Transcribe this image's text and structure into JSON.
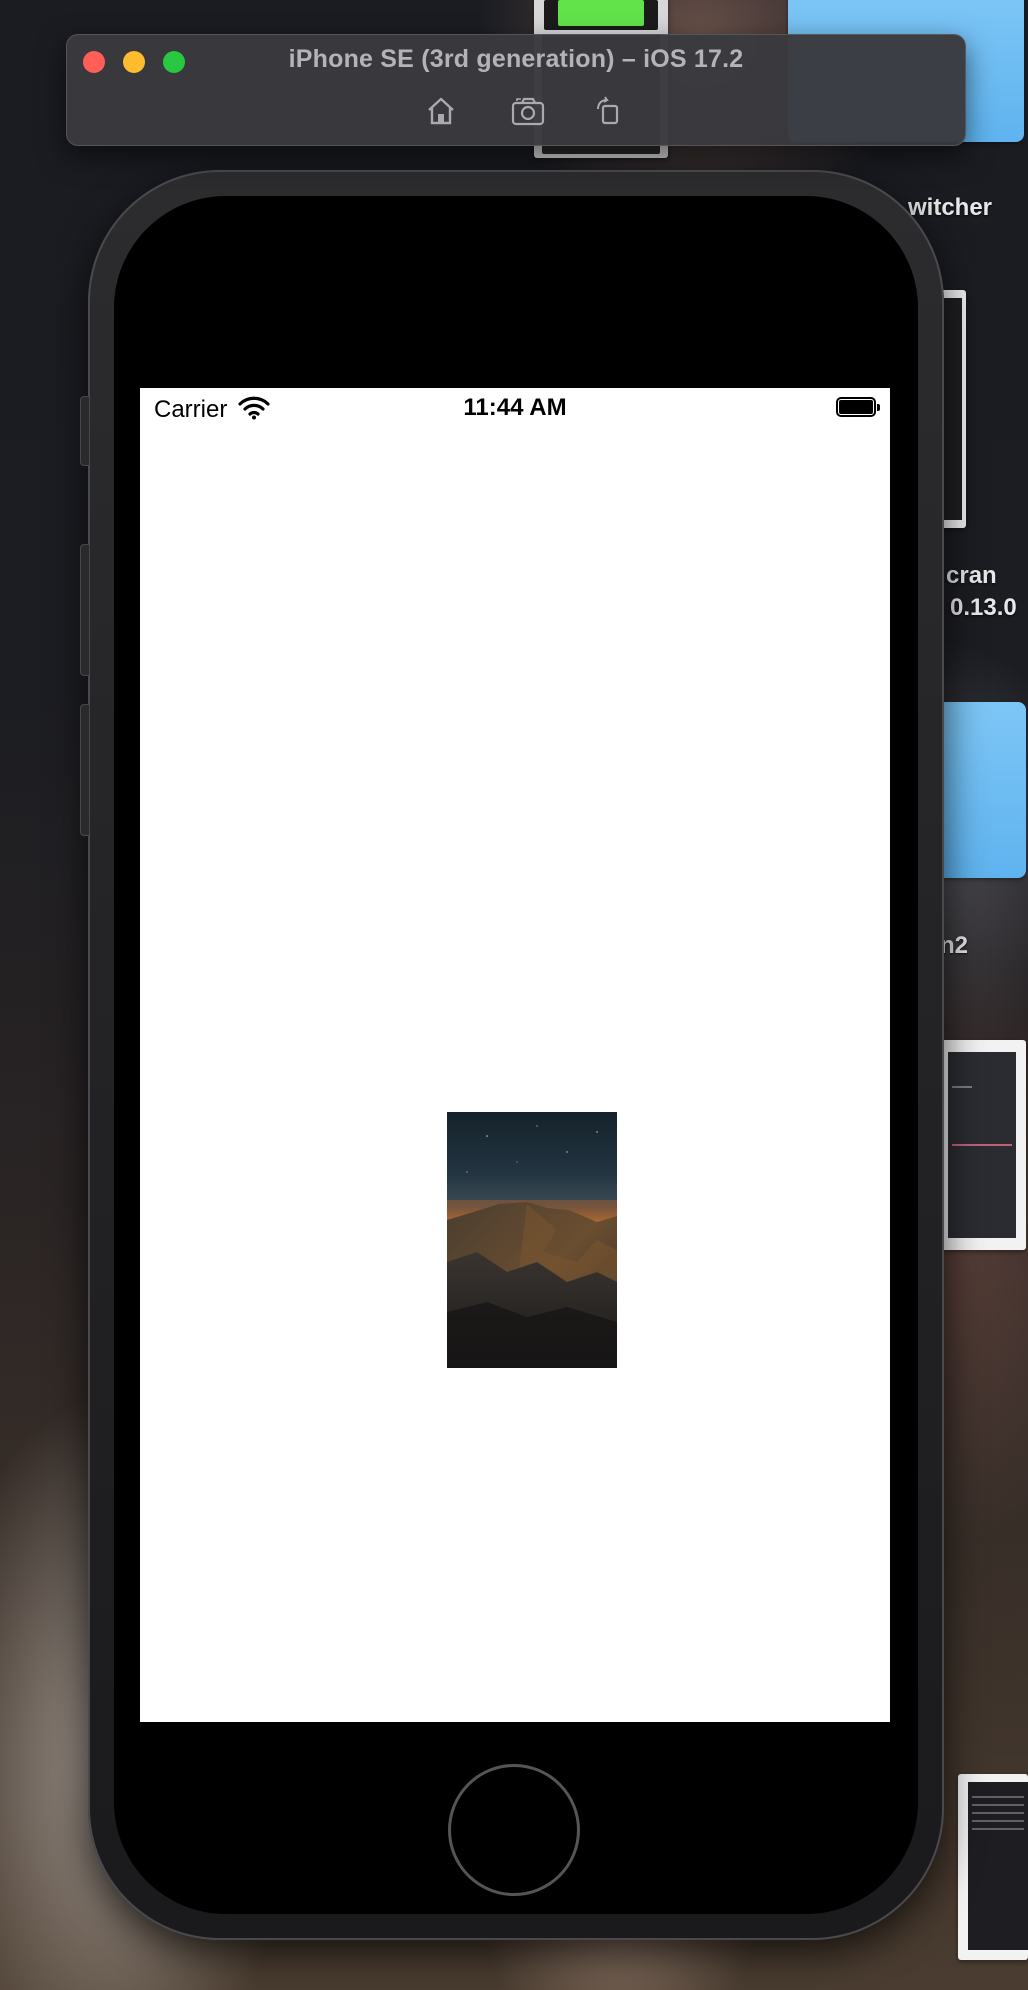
{
  "simulator": {
    "title": "iPhone SE (3rd generation) – iOS 17.2",
    "toolbar": {
      "home_icon": "home-icon",
      "screenshot_icon": "camera-icon",
      "rotate_icon": "rotate-icon"
    }
  },
  "desktop": {
    "labels": {
      "switcher": "witcher",
      "cran": "cran",
      "version": "0.13.0",
      "n2": "n2"
    }
  },
  "status_bar": {
    "carrier": "Carrier",
    "time": "11:44 AM",
    "wifi_icon": "wifi-icon",
    "battery_icon": "battery-icon"
  },
  "content": {
    "image": "mountain-night-photo"
  },
  "colors": {
    "close": "#ff5f57",
    "minimize": "#febc2e",
    "maximize": "#28c840",
    "folder": "#6bbcf3",
    "screen_bg": "#ffffff"
  }
}
